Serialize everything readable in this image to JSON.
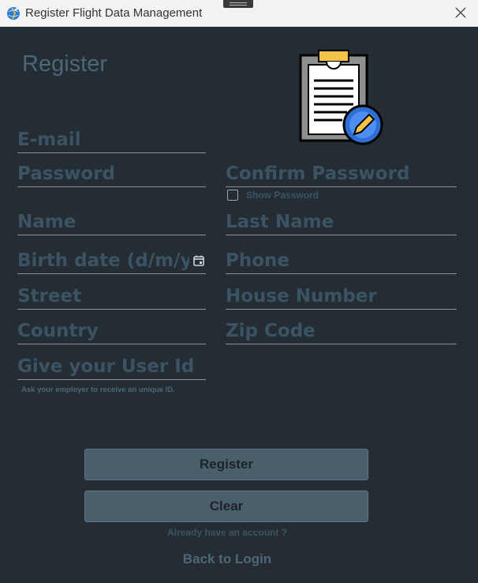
{
  "titlebar": {
    "title": "Register Flight Data Management",
    "app_icon": "globe-plane-icon",
    "close_icon": "close-icon"
  },
  "form": {
    "heading": "Register",
    "illustration": "clipboard-edit-icon",
    "fields": {
      "email": "E-mail",
      "password": "Password",
      "confirm_password": "Confirm Password",
      "name": "Name",
      "last_name": "Last Name",
      "birth_date": "Birth date (d/m/y)",
      "phone": "Phone",
      "street": "Street",
      "house_number": "House Number",
      "country": "Country",
      "zip_code": "Zip Code",
      "user_id": "Give your User Id"
    },
    "show_password": {
      "label": "Show Password",
      "checked": false
    },
    "user_id_hint": "Ask your employer to receive an unique ID.",
    "register_label": "Register",
    "clear_label": "Clear",
    "already_text": "Already have an account ?",
    "back_label": "Back to Login"
  },
  "colors": {
    "background": "#242d34",
    "placeholder": "#3c5363",
    "button": "#4a5f6c",
    "underline": "#8393a0"
  }
}
